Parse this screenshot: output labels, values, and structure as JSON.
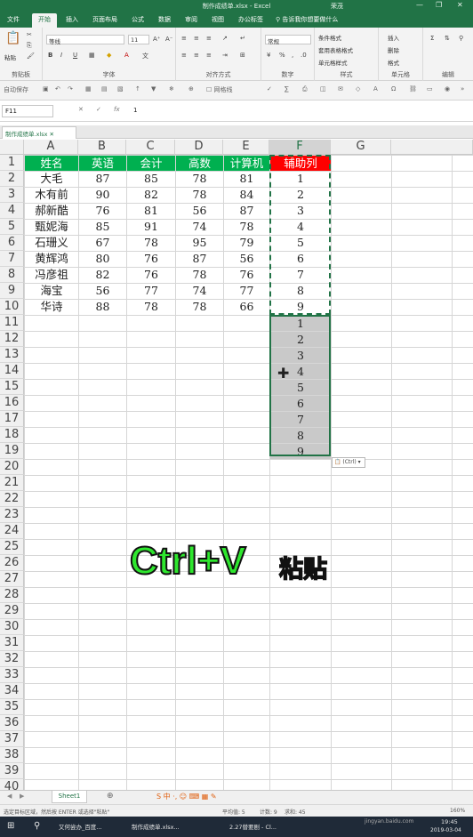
{
  "titlebar": {
    "title": "制作成绩单.xlsx - Excel",
    "user": "荣茂"
  },
  "tabs": [
    {
      "label": "文件"
    },
    {
      "label": "开始"
    },
    {
      "label": "插入"
    },
    {
      "label": "页面布局"
    },
    {
      "label": "公式"
    },
    {
      "label": "数据"
    },
    {
      "label": "审阅"
    },
    {
      "label": "视图"
    },
    {
      "label": "办公标签"
    }
  ],
  "tell": "告诉我你想要做什么",
  "ribbon": {
    "paste": "粘贴",
    "clipboard": "剪贴板",
    "font_name": "等线",
    "font_size": "11",
    "font": "字体",
    "align": "对齐方式",
    "number_format": "常规",
    "number": "数字",
    "cond_format": "条件格式",
    "table_format": "套用表格格式",
    "cell_style": "单元格样式",
    "styles": "样式",
    "insert": "插入",
    "delete": "删除",
    "format": "格式",
    "cells": "单元格",
    "edit": "编辑"
  },
  "qa": {
    "autosave": "自动保存",
    "gridlines": "网格线"
  },
  "formula": {
    "name_box": "F11",
    "value": "1"
  },
  "doc_tab": "制作成绩单.xlsx",
  "columns": [
    "A",
    "B",
    "C",
    "D",
    "E",
    "F",
    "G"
  ],
  "rows": [
    "1",
    "2",
    "3",
    "4",
    "5",
    "6",
    "7",
    "8",
    "9",
    "10",
    "11",
    "12",
    "13",
    "14",
    "15",
    "16",
    "17",
    "18",
    "19",
    "20",
    "21",
    "22",
    "23",
    "24",
    "25",
    "26",
    "27",
    "28",
    "29",
    "30",
    "31",
    "32",
    "33",
    "34",
    "35",
    "36",
    "37",
    "38",
    "39",
    "40"
  ],
  "table": {
    "headers": [
      "姓名",
      "英语",
      "会计",
      "高数",
      "计算机",
      "辅助列"
    ],
    "data": [
      [
        "大毛",
        "87",
        "85",
        "78",
        "81",
        "1"
      ],
      [
        "木有前",
        "90",
        "82",
        "78",
        "84",
        "2"
      ],
      [
        "郝新酷",
        "76",
        "81",
        "56",
        "87",
        "3"
      ],
      [
        "甄妮海",
        "85",
        "91",
        "74",
        "78",
        "4"
      ],
      [
        "石珊义",
        "67",
        "78",
        "95",
        "79",
        "5"
      ],
      [
        "黄辉鸿",
        "80",
        "76",
        "87",
        "56",
        "6"
      ],
      [
        "冯彦祖",
        "82",
        "76",
        "78",
        "76",
        "7"
      ],
      [
        "海宝",
        "56",
        "77",
        "74",
        "77",
        "8"
      ],
      [
        "华诗",
        "88",
        "78",
        "78",
        "66",
        "9"
      ]
    ],
    "pasted": [
      "1",
      "2",
      "3",
      "4",
      "5",
      "6",
      "7",
      "8",
      "9"
    ]
  },
  "paste_options": "(Ctrl)",
  "overlay": {
    "keys": "Ctrl+V",
    "word": "粘贴"
  },
  "sheet_tab": "Sheet1",
  "status": {
    "hint": "选定目标区域，然后按 ENTER 或选择\"粘贴\"",
    "average": "平均值: 5",
    "count": "计数: 9",
    "sum": "求和: 45",
    "zoom": "160%"
  },
  "taskbar": {
    "items": [
      "又何尝办_百度...",
      "制作成绩单.xlsx...",
      "2.27替要剧 - Cl..."
    ],
    "time": "19:45",
    "date": "2019-03-04",
    "watermark": "jingyan.baidu.com"
  }
}
